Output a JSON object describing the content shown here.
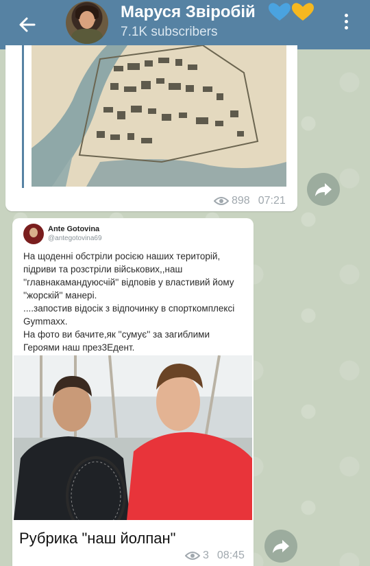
{
  "header": {
    "title": "Маруся Звіробій",
    "subscribers": "7.1K subscribers",
    "colors": {
      "bar": "#5682a3",
      "heart_left": "#4aa3e0",
      "heart_right": "#f5b820"
    }
  },
  "messages": [
    {
      "views": "898",
      "time": "07:21",
      "media": "map-image"
    },
    {
      "tweet": {
        "author": "Ante Gotovina",
        "handle": "@antegotovina69",
        "text": "На щоденні обстріли росією наших територій,\nпідриви та розстріли військових,,наш\n''главнакамандуюсчій'' відповів у  властивий йому\n''жорскій'' манері.\n....запостив відосік з відпочинку в спорткомплексі\nGymmaxx.\nНа фото ви бачите,як ''сумує'' за загиблими\nГероями наш през3Едент."
      },
      "caption": "Рубрика \"наш йолпан\"",
      "views": "3",
      "time": "08:45",
      "media": "photo-image"
    }
  ]
}
